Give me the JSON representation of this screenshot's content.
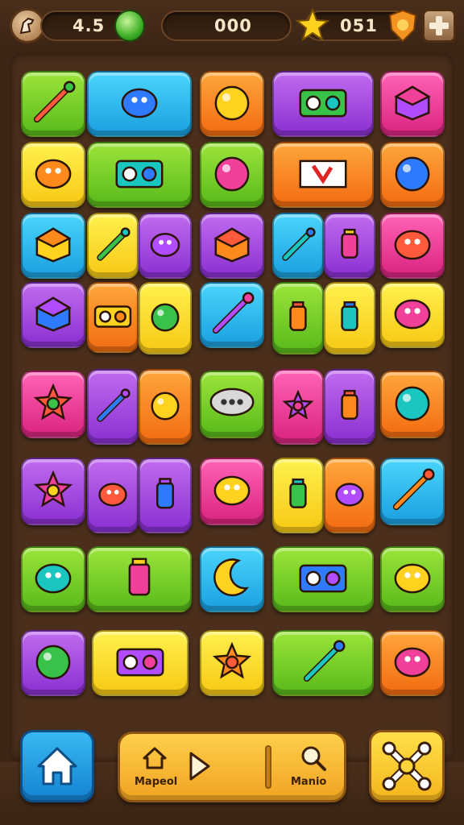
{
  "hud": {
    "lives_value": "4.5",
    "center_value": "000",
    "stars_value": "051"
  },
  "bottom_nav": {
    "left_label": "Mapeol",
    "right_label": "Manio"
  },
  "icons": {
    "profile": "horse-icon",
    "gem": "green-gem-icon",
    "star": "star-icon",
    "shield": "shield-icon",
    "add": "plus-icon",
    "home": "home-icon",
    "play": "play-icon",
    "search": "magnifier-icon",
    "settings": "bone-cross-icon"
  },
  "colors": {
    "green": "#7ed321",
    "cyan": "#2fc3f0",
    "orange": "#ff8a1c",
    "purple": "#a443e0",
    "yellow": "#ffe22e",
    "pink": "#f0409a",
    "board": "#4b2f1c"
  },
  "board": {
    "tiles": [
      {
        "color": "green",
        "icon": "dagger-icon"
      },
      {
        "color": "cyan",
        "icon": "bucket-and-tool-icon"
      },
      {
        "color": "orange",
        "icon": "ball-icon"
      },
      {
        "color": "purple",
        "icon": "radio-icon"
      },
      {
        "color": "pink",
        "icon": "box-icon"
      },
      {
        "color": "yellow",
        "icon": "rings-icon"
      },
      {
        "color": "green",
        "icon": "toolbox-icon"
      },
      {
        "color": "green",
        "icon": "apple-icon"
      },
      {
        "color": "orange",
        "icon": "flag-icon"
      },
      {
        "color": "orange",
        "icon": "pear-icon"
      },
      {
        "color": "cyan",
        "icon": "bread-icon"
      },
      {
        "color": "yellow",
        "icon": "carrot-icon"
      },
      {
        "color": "purple",
        "icon": "capsule-icon"
      },
      {
        "color": "purple",
        "icon": "cube-icon"
      },
      {
        "color": "cyan",
        "icon": "pencil-icon"
      },
      {
        "color": "purple",
        "icon": "tube-icon"
      },
      {
        "color": "pink",
        "icon": "rocket-icon"
      },
      {
        "color": "purple",
        "icon": "cheese-icon"
      },
      {
        "color": "orange",
        "icon": "camera-icon"
      },
      {
        "color": "yellow",
        "icon": "striped-ball-icon"
      },
      {
        "color": "cyan",
        "icon": "lollipop-icon"
      },
      {
        "color": "green",
        "icon": "bottle-icon"
      },
      {
        "color": "yellow",
        "icon": "jar-icon"
      },
      {
        "color": "yellow",
        "icon": "popsicle-icon"
      },
      {
        "color": "pink",
        "icon": "gear-icon"
      },
      {
        "color": "purple",
        "icon": "wand-icon"
      },
      {
        "color": "orange",
        "icon": "bulb-icon"
      },
      {
        "color": "green",
        "icon": "speech-bubble-icon"
      },
      {
        "color": "pink",
        "icon": "medal-icon"
      },
      {
        "color": "purple",
        "icon": "potion-icon"
      },
      {
        "color": "orange",
        "icon": "target-icon"
      },
      {
        "color": "purple",
        "icon": "star-tile-icon"
      },
      {
        "color": "purple",
        "icon": "bug-icon"
      },
      {
        "color": "purple",
        "icon": "battery-icon"
      },
      {
        "color": "pink",
        "icon": "ghost-icon"
      },
      {
        "color": "yellow",
        "icon": "chess-piece-icon"
      },
      {
        "color": "orange",
        "icon": "plant-icon"
      },
      {
        "color": "cyan",
        "icon": "crayon-icon"
      },
      {
        "color": "green",
        "icon": "leaf-icon"
      },
      {
        "color": "green",
        "icon": "honey-jar-icon"
      },
      {
        "color": "cyan",
        "icon": "moon-icon"
      },
      {
        "color": "green",
        "icon": "photo-camera-icon"
      },
      {
        "color": "green",
        "icon": "fish-icon"
      },
      {
        "color": "purple",
        "icon": "lemon-icon"
      },
      {
        "color": "yellow",
        "icon": "monitor-icon"
      },
      {
        "color": "yellow",
        "icon": "sun-icon"
      },
      {
        "color": "green",
        "icon": "sword-icon"
      },
      {
        "color": "orange",
        "icon": "caterpillar-icon"
      }
    ]
  }
}
